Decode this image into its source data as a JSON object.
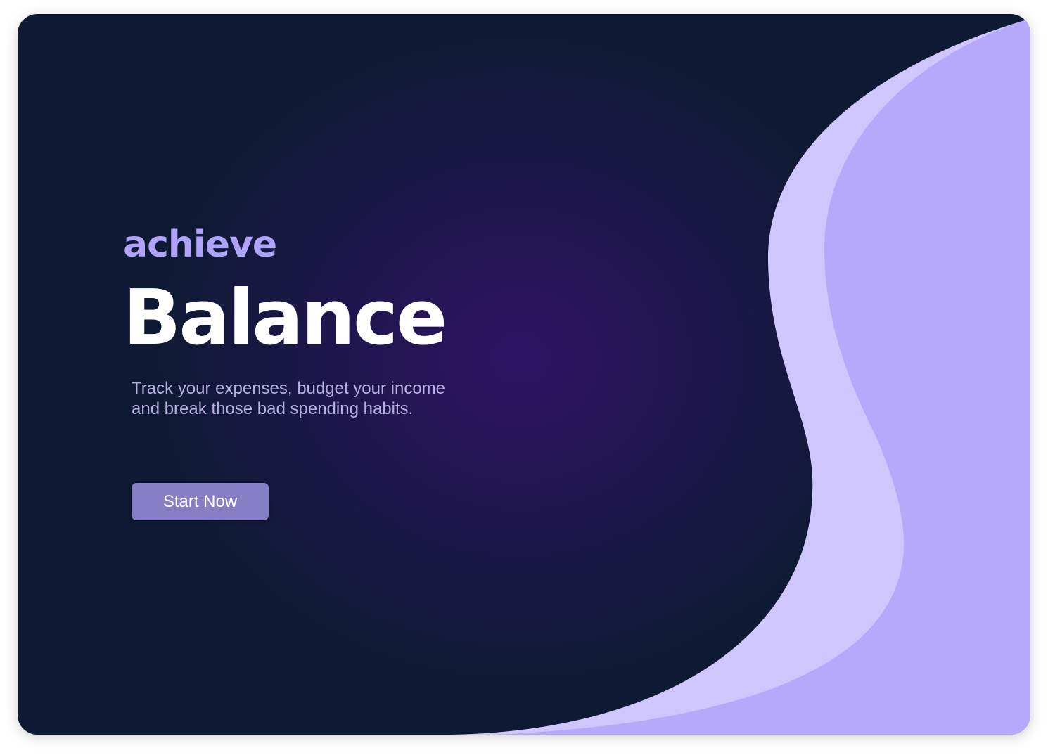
{
  "hero": {
    "kicker": "achieve",
    "title": "Balance",
    "description": "Track your expenses, budget your income and break those bad spending habits.",
    "cta_label": "Start Now"
  },
  "colors": {
    "background": "#0e1a33",
    "glow": "#2e1462",
    "wave_light": "#cfc6fd",
    "wave_dark": "#b6a9fc",
    "accent": "#b0a3fb",
    "button": "#877fc6"
  }
}
